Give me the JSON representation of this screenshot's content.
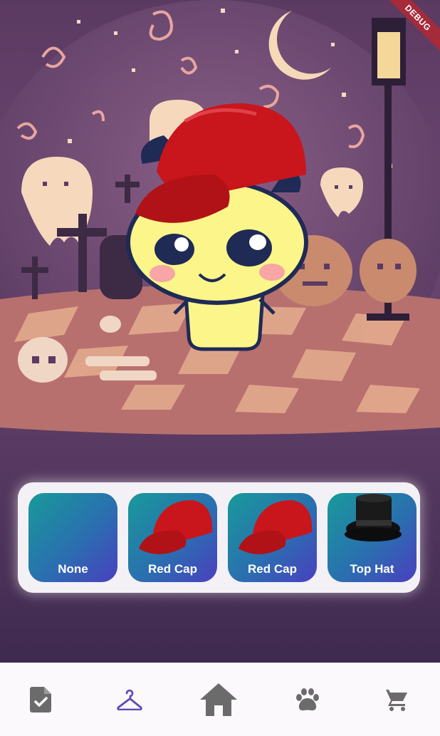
{
  "app": {
    "debug_banner": "DEBUG"
  },
  "wardrobe": {
    "items": [
      {
        "label": "None",
        "icon": "empty"
      },
      {
        "label": "Red Cap",
        "icon": "red-cap-icon"
      },
      {
        "label": "Red Cap",
        "icon": "red-cap-icon"
      },
      {
        "label": "Top Hat",
        "icon": "top-hat-icon"
      }
    ]
  },
  "nav": {
    "items": [
      {
        "name": "tasks",
        "icon": "task-document-icon"
      },
      {
        "name": "wardrobe",
        "icon": "hanger-icon",
        "selected": true
      },
      {
        "name": "home",
        "icon": "home-icon"
      },
      {
        "name": "pets",
        "icon": "paw-icon"
      },
      {
        "name": "shop",
        "icon": "cart-icon"
      }
    ]
  },
  "colors": {
    "accent": "#5e4bb8",
    "nav_icon": "#6b6b6b",
    "item_gradient_start": "#189a9a",
    "item_gradient_end": "#4a3fbf"
  }
}
